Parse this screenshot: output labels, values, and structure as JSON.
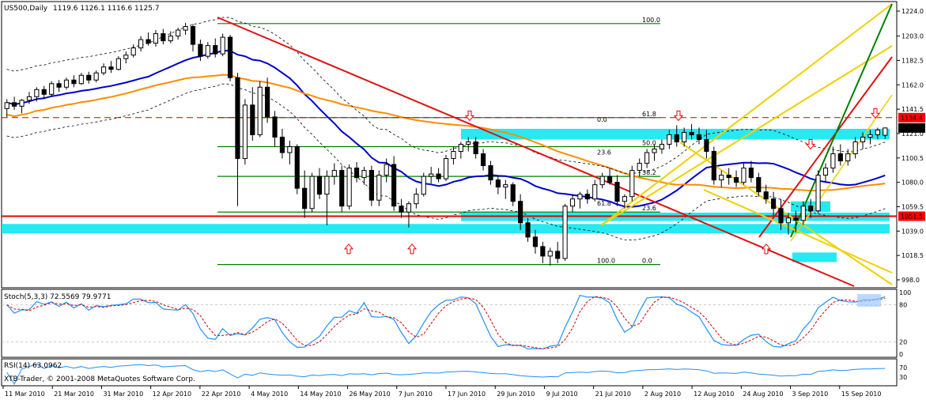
{
  "chart_data": {
    "type": "candlestick",
    "symbol": "US500,Daily",
    "ohlc_label": "1119.6 1126.1 1116.6 1125.7",
    "copyright": "XTB-Trader, © 2001-2008 MetaQuotes Software Corp.",
    "price_axis": {
      "min": 998,
      "max": 1224,
      "ticks": [
        "1224.0",
        "1203.0",
        "1182.5",
        "1162.0",
        "1141.5",
        "1121.0",
        "1100.5",
        "1080.0",
        "1059.5",
        "1039.0",
        "1018.5",
        "998.0"
      ]
    },
    "price_tags": [
      {
        "label": "1134.4",
        "value": 1134.4,
        "bg": "#ff0000",
        "fg": "#ffffff"
      },
      {
        "label": "1125.7",
        "value": 1125.7,
        "bg": "#000000",
        "fg": "#ffffff"
      },
      {
        "label": "1051.5",
        "value": 1051.5,
        "bg": "#ff0000",
        "fg": "#ffffff"
      }
    ],
    "date_labels": [
      "11 Mar 2010",
      "21 Mar 2010",
      "31 Mar 2010",
      "12 Apr 2010",
      "22 Apr 2010",
      "4 May 2010",
      "14 May 2010",
      "26 May 2010",
      "7 Jun 2010",
      "17 Jun 2010",
      "29 Jun 2010",
      "9 Jul 2010",
      "21 Jul 2010",
      "2 Aug 2010",
      "12 Aug 2010",
      "24 Aug 2010",
      "3 Sep 2010",
      "15 Sep 2010"
    ],
    "candles": [
      [
        1142,
        1150,
        1135,
        1147
      ],
      [
        1147,
        1152,
        1141,
        1144
      ],
      [
        1144,
        1150,
        1138,
        1149
      ],
      [
        1149,
        1156,
        1146,
        1152
      ],
      [
        1152,
        1160,
        1148,
        1158
      ],
      [
        1158,
        1161,
        1150,
        1154
      ],
      [
        1154,
        1165,
        1152,
        1163
      ],
      [
        1163,
        1166,
        1156,
        1160
      ],
      [
        1160,
        1168,
        1158,
        1166
      ],
      [
        1166,
        1170,
        1160,
        1163
      ],
      [
        1163,
        1172,
        1162,
        1170
      ],
      [
        1170,
        1173,
        1163,
        1166
      ],
      [
        1166,
        1174,
        1164,
        1172
      ],
      [
        1172,
        1180,
        1170,
        1177
      ],
      [
        1177,
        1182,
        1172,
        1175
      ],
      [
        1175,
        1186,
        1174,
        1184
      ],
      [
        1184,
        1190,
        1180,
        1187
      ],
      [
        1187,
        1196,
        1185,
        1193
      ],
      [
        1193,
        1203,
        1190,
        1200
      ],
      [
        1200,
        1206,
        1195,
        1197
      ],
      [
        1197,
        1208,
        1194,
        1205
      ],
      [
        1205,
        1209,
        1196,
        1199
      ],
      [
        1199,
        1207,
        1197,
        1203
      ],
      [
        1203,
        1210,
        1200,
        1208
      ],
      [
        1208,
        1214,
        1204,
        1211
      ],
      [
        1211,
        1213,
        1190,
        1196
      ],
      [
        1196,
        1200,
        1182,
        1186
      ],
      [
        1186,
        1198,
        1184,
        1195
      ],
      [
        1195,
        1201,
        1185,
        1188
      ],
      [
        1188,
        1205,
        1186,
        1202
      ],
      [
        1202,
        1204,
        1165,
        1168
      ],
      [
        1168,
        1172,
        1060,
        1100
      ],
      [
        1100,
        1150,
        1095,
        1145
      ],
      [
        1145,
        1160,
        1115,
        1120
      ],
      [
        1120,
        1165,
        1118,
        1160
      ],
      [
        1160,
        1168,
        1130,
        1135
      ],
      [
        1135,
        1140,
        1110,
        1118
      ],
      [
        1118,
        1125,
        1100,
        1105
      ],
      [
        1105,
        1115,
        1095,
        1110
      ],
      [
        1110,
        1112,
        1070,
        1075
      ],
      [
        1075,
        1090,
        1050,
        1058
      ],
      [
        1058,
        1088,
        1055,
        1085
      ],
      [
        1085,
        1092,
        1066,
        1070
      ],
      [
        1070,
        1090,
        1044,
        1085
      ],
      [
        1085,
        1096,
        1078,
        1090
      ],
      [
        1090,
        1094,
        1055,
        1060
      ],
      [
        1060,
        1095,
        1057,
        1092
      ],
      [
        1092,
        1097,
        1080,
        1084
      ],
      [
        1084,
        1093,
        1078,
        1090
      ],
      [
        1090,
        1094,
        1060,
        1065
      ],
      [
        1065,
        1090,
        1060,
        1086
      ],
      [
        1086,
        1100,
        1080,
        1095
      ],
      [
        1095,
        1102,
        1056,
        1060
      ],
      [
        1060,
        1066,
        1050,
        1055
      ],
      [
        1055,
        1064,
        1042,
        1062
      ],
      [
        1062,
        1075,
        1058,
        1070
      ],
      [
        1070,
        1088,
        1068,
        1085
      ],
      [
        1085,
        1093,
        1079,
        1087
      ],
      [
        1087,
        1092,
        1080,
        1083
      ],
      [
        1083,
        1103,
        1081,
        1100
      ],
      [
        1100,
        1110,
        1095,
        1106
      ],
      [
        1106,
        1114,
        1100,
        1112
      ],
      [
        1112,
        1118,
        1106,
        1114
      ],
      [
        1114,
        1118,
        1100,
        1104
      ],
      [
        1104,
        1108,
        1090,
        1094
      ],
      [
        1094,
        1098,
        1078,
        1082
      ],
      [
        1082,
        1086,
        1070,
        1076
      ],
      [
        1076,
        1082,
        1066,
        1078
      ],
      [
        1078,
        1080,
        1060,
        1064
      ],
      [
        1064,
        1070,
        1040,
        1046
      ],
      [
        1046,
        1050,
        1030,
        1034
      ],
      [
        1034,
        1040,
        1020,
        1026
      ],
      [
        1026,
        1030,
        1012,
        1018
      ],
      [
        1018,
        1025,
        1010,
        1022
      ],
      [
        1022,
        1030,
        1012,
        1016
      ],
      [
        1016,
        1062,
        1014,
        1060
      ],
      [
        1060,
        1070,
        1055,
        1066
      ],
      [
        1066,
        1072,
        1058,
        1070
      ],
      [
        1070,
        1074,
        1062,
        1066
      ],
      [
        1066,
        1082,
        1064,
        1078
      ],
      [
        1078,
        1088,
        1075,
        1085
      ],
      [
        1085,
        1092,
        1078,
        1080
      ],
      [
        1080,
        1086,
        1060,
        1064
      ],
      [
        1064,
        1070,
        1058,
        1068
      ],
      [
        1068,
        1094,
        1064,
        1090
      ],
      [
        1090,
        1100,
        1085,
        1096
      ],
      [
        1096,
        1108,
        1092,
        1105
      ],
      [
        1105,
        1112,
        1098,
        1108
      ],
      [
        1108,
        1116,
        1104,
        1112
      ],
      [
        1112,
        1124,
        1108,
        1120
      ],
      [
        1120,
        1128,
        1110,
        1114
      ],
      [
        1114,
        1126,
        1110,
        1122
      ],
      [
        1122,
        1129,
        1116,
        1120
      ],
      [
        1120,
        1126,
        1112,
        1116
      ],
      [
        1116,
        1124,
        1100,
        1106
      ],
      [
        1106,
        1110,
        1078,
        1082
      ],
      [
        1082,
        1090,
        1076,
        1086
      ],
      [
        1086,
        1092,
        1078,
        1084
      ],
      [
        1084,
        1090,
        1076,
        1080
      ],
      [
        1080,
        1096,
        1078,
        1092
      ],
      [
        1092,
        1098,
        1080,
        1084
      ],
      [
        1084,
        1088,
        1068,
        1072
      ],
      [
        1072,
        1078,
        1062,
        1066
      ],
      [
        1066,
        1072,
        1052,
        1058
      ],
      [
        1058,
        1066,
        1040,
        1046
      ],
      [
        1046,
        1054,
        1036,
        1050
      ],
      [
        1050,
        1056,
        1038,
        1048
      ],
      [
        1048,
        1064,
        1044,
        1060
      ],
      [
        1060,
        1066,
        1050,
        1056
      ],
      [
        1056,
        1090,
        1054,
        1086
      ],
      [
        1086,
        1096,
        1080,
        1092
      ],
      [
        1092,
        1110,
        1088,
        1104
      ],
      [
        1104,
        1112,
        1094,
        1098
      ],
      [
        1098,
        1108,
        1094,
        1104
      ],
      [
        1104,
        1118,
        1100,
        1114
      ],
      [
        1114,
        1122,
        1108,
        1118
      ],
      [
        1118,
        1124,
        1112,
        1120
      ],
      [
        1120,
        1126,
        1116,
        1124
      ],
      [
        1119.6,
        1126.1,
        1116.6,
        1125.7
      ]
    ],
    "fib_left": [
      {
        "label": "100.0",
        "value": 1213.5
      },
      {
        "label": "61.8",
        "value": 1134.4
      },
      {
        "label": "50.0",
        "value": 1110
      },
      {
        "label": "38.2",
        "value": 1085
      },
      {
        "label": "23.6",
        "value": 1055
      },
      {
        "label": "0.0",
        "value": 1010.9
      }
    ],
    "fib_right": [
      {
        "label": "0.0",
        "value": 1129.5
      },
      {
        "label": "23.6",
        "value": 1102
      },
      {
        "label": "61.8",
        "value": 1059
      },
      {
        "label": "100.0",
        "value": 1010.9
      }
    ],
    "stoch": {
      "label": "Stoch(5,3,3) 72.5569 79.9771",
      "levels": [
        "100",
        "80",
        "20",
        "0"
      ]
    },
    "rsi": {
      "label": "RSI(14) 63.0962",
      "levels": [
        "70",
        "30"
      ]
    },
    "colors": {
      "bull": "#ffffff",
      "bear": "#000000",
      "ma_blue": "#0000cc",
      "ma_orange": "#ff8c00",
      "trend_red": "#e01010",
      "fib_green": "#008000",
      "fan_yellow": "#f0d000",
      "zone": "#00e5ee",
      "stoch_main": "#1e90ff",
      "stoch_signal": "#cc0000"
    }
  }
}
